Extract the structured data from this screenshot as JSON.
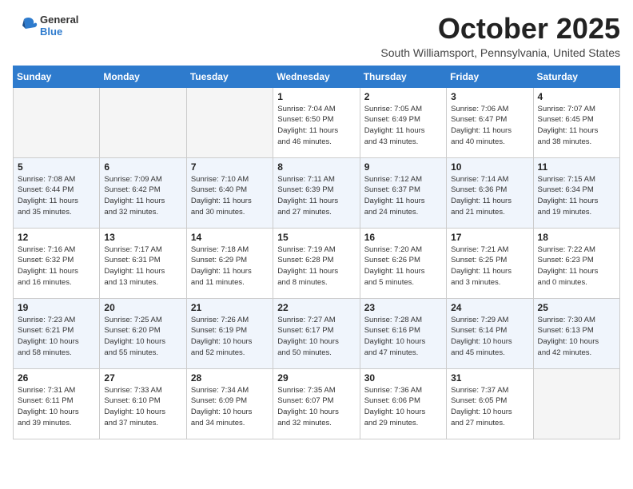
{
  "header": {
    "logo_line1": "General",
    "logo_line2": "Blue",
    "title": "October 2025",
    "subtitle": "South Williamsport, Pennsylvania, United States"
  },
  "columns": [
    "Sunday",
    "Monday",
    "Tuesday",
    "Wednesday",
    "Thursday",
    "Friday",
    "Saturday"
  ],
  "weeks": [
    [
      {
        "day": "",
        "info": ""
      },
      {
        "day": "",
        "info": ""
      },
      {
        "day": "",
        "info": ""
      },
      {
        "day": "1",
        "info": "Sunrise: 7:04 AM\nSunset: 6:50 PM\nDaylight: 11 hours\nand 46 minutes."
      },
      {
        "day": "2",
        "info": "Sunrise: 7:05 AM\nSunset: 6:49 PM\nDaylight: 11 hours\nand 43 minutes."
      },
      {
        "day": "3",
        "info": "Sunrise: 7:06 AM\nSunset: 6:47 PM\nDaylight: 11 hours\nand 40 minutes."
      },
      {
        "day": "4",
        "info": "Sunrise: 7:07 AM\nSunset: 6:45 PM\nDaylight: 11 hours\nand 38 minutes."
      }
    ],
    [
      {
        "day": "5",
        "info": "Sunrise: 7:08 AM\nSunset: 6:44 PM\nDaylight: 11 hours\nand 35 minutes."
      },
      {
        "day": "6",
        "info": "Sunrise: 7:09 AM\nSunset: 6:42 PM\nDaylight: 11 hours\nand 32 minutes."
      },
      {
        "day": "7",
        "info": "Sunrise: 7:10 AM\nSunset: 6:40 PM\nDaylight: 11 hours\nand 30 minutes."
      },
      {
        "day": "8",
        "info": "Sunrise: 7:11 AM\nSunset: 6:39 PM\nDaylight: 11 hours\nand 27 minutes."
      },
      {
        "day": "9",
        "info": "Sunrise: 7:12 AM\nSunset: 6:37 PM\nDaylight: 11 hours\nand 24 minutes."
      },
      {
        "day": "10",
        "info": "Sunrise: 7:14 AM\nSunset: 6:36 PM\nDaylight: 11 hours\nand 21 minutes."
      },
      {
        "day": "11",
        "info": "Sunrise: 7:15 AM\nSunset: 6:34 PM\nDaylight: 11 hours\nand 19 minutes."
      }
    ],
    [
      {
        "day": "12",
        "info": "Sunrise: 7:16 AM\nSunset: 6:32 PM\nDaylight: 11 hours\nand 16 minutes."
      },
      {
        "day": "13",
        "info": "Sunrise: 7:17 AM\nSunset: 6:31 PM\nDaylight: 11 hours\nand 13 minutes."
      },
      {
        "day": "14",
        "info": "Sunrise: 7:18 AM\nSunset: 6:29 PM\nDaylight: 11 hours\nand 11 minutes."
      },
      {
        "day": "15",
        "info": "Sunrise: 7:19 AM\nSunset: 6:28 PM\nDaylight: 11 hours\nand 8 minutes."
      },
      {
        "day": "16",
        "info": "Sunrise: 7:20 AM\nSunset: 6:26 PM\nDaylight: 11 hours\nand 5 minutes."
      },
      {
        "day": "17",
        "info": "Sunrise: 7:21 AM\nSunset: 6:25 PM\nDaylight: 11 hours\nand 3 minutes."
      },
      {
        "day": "18",
        "info": "Sunrise: 7:22 AM\nSunset: 6:23 PM\nDaylight: 11 hours\nand 0 minutes."
      }
    ],
    [
      {
        "day": "19",
        "info": "Sunrise: 7:23 AM\nSunset: 6:21 PM\nDaylight: 10 hours\nand 58 minutes."
      },
      {
        "day": "20",
        "info": "Sunrise: 7:25 AM\nSunset: 6:20 PM\nDaylight: 10 hours\nand 55 minutes."
      },
      {
        "day": "21",
        "info": "Sunrise: 7:26 AM\nSunset: 6:19 PM\nDaylight: 10 hours\nand 52 minutes."
      },
      {
        "day": "22",
        "info": "Sunrise: 7:27 AM\nSunset: 6:17 PM\nDaylight: 10 hours\nand 50 minutes."
      },
      {
        "day": "23",
        "info": "Sunrise: 7:28 AM\nSunset: 6:16 PM\nDaylight: 10 hours\nand 47 minutes."
      },
      {
        "day": "24",
        "info": "Sunrise: 7:29 AM\nSunset: 6:14 PM\nDaylight: 10 hours\nand 45 minutes."
      },
      {
        "day": "25",
        "info": "Sunrise: 7:30 AM\nSunset: 6:13 PM\nDaylight: 10 hours\nand 42 minutes."
      }
    ],
    [
      {
        "day": "26",
        "info": "Sunrise: 7:31 AM\nSunset: 6:11 PM\nDaylight: 10 hours\nand 39 minutes."
      },
      {
        "day": "27",
        "info": "Sunrise: 7:33 AM\nSunset: 6:10 PM\nDaylight: 10 hours\nand 37 minutes."
      },
      {
        "day": "28",
        "info": "Sunrise: 7:34 AM\nSunset: 6:09 PM\nDaylight: 10 hours\nand 34 minutes."
      },
      {
        "day": "29",
        "info": "Sunrise: 7:35 AM\nSunset: 6:07 PM\nDaylight: 10 hours\nand 32 minutes."
      },
      {
        "day": "30",
        "info": "Sunrise: 7:36 AM\nSunset: 6:06 PM\nDaylight: 10 hours\nand 29 minutes."
      },
      {
        "day": "31",
        "info": "Sunrise: 7:37 AM\nSunset: 6:05 PM\nDaylight: 10 hours\nand 27 minutes."
      },
      {
        "day": "",
        "info": ""
      }
    ]
  ]
}
